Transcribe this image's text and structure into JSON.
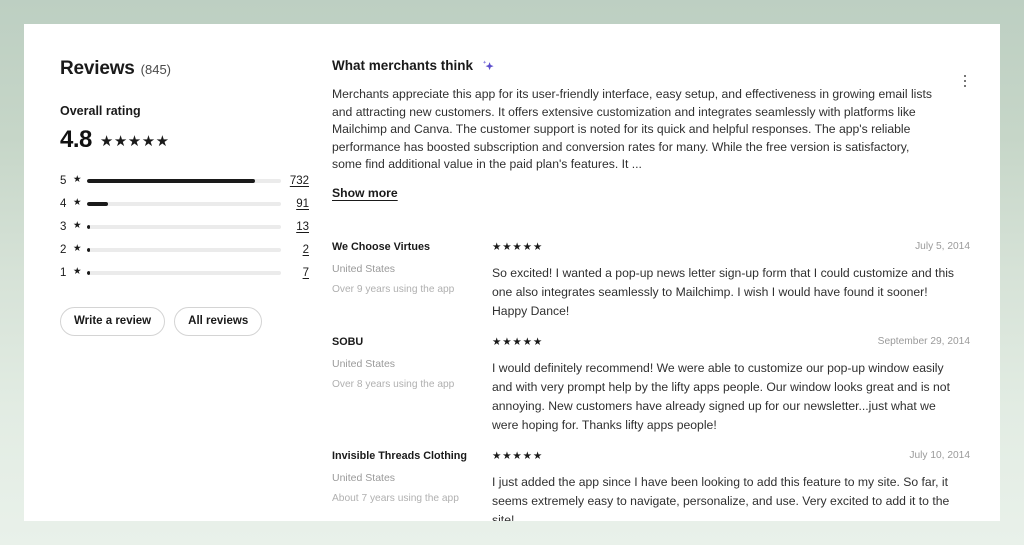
{
  "page": {
    "background_top": "#bdcfc2",
    "background_bottom": "#e9f1ea",
    "card_background": "#ffffff"
  },
  "sidebar": {
    "title": "Reviews",
    "count_label": "(845)",
    "overall_rating_label": "Overall rating",
    "score": "4.8",
    "score_stars": "★★★★★",
    "rating_bars": [
      {
        "stars": "5",
        "star_glyph": "★",
        "count": "732",
        "percent": 86.6
      },
      {
        "stars": "4",
        "star_glyph": "★",
        "count": "91",
        "percent": 10.8
      },
      {
        "stars": "3",
        "star_glyph": "★",
        "count": "13",
        "percent": 1.6
      },
      {
        "stars": "2",
        "star_glyph": "★",
        "count": "2",
        "percent": 0.3
      },
      {
        "stars": "1",
        "star_glyph": "★",
        "count": "7",
        "percent": 0.9
      }
    ],
    "write_review_label": "Write a review",
    "all_reviews_label": "All reviews"
  },
  "merchants_summary": {
    "title": "What merchants think",
    "ai_icon": "sparkle-icon",
    "ai_icon_color": "#5c4ecc",
    "menu_icon": "kebab-menu-icon",
    "body": "Merchants appreciate this app for its user-friendly interface, easy setup, and effectiveness in growing email lists and attracting new customers. It offers extensive customization and integrates seamlessly with platforms like Mailchimp and Canva. The customer support is noted for its quick and helpful responses. The app's reliable performance has boosted subscription and conversion rates for many. While the free version is satisfactory, some find additional value in the paid plan's features. It ...",
    "show_more_label": "Show more"
  },
  "reviews": [
    {
      "shop": "We Choose Virtues",
      "country": "United States",
      "duration": "Over 9 years using the app",
      "stars": "★★★★★",
      "date": "July 5, 2014",
      "text": "So excited! I wanted a pop-up news letter sign-up form that I could customize and this one also integrates seamlessly to Mailchimp. I wish I would have found it sooner! Happy Dance!"
    },
    {
      "shop": "SOBU",
      "country": "United States",
      "duration": "Over 8 years using the app",
      "stars": "★★★★★",
      "date": "September 29, 2014",
      "text": "I would definitely recommend! We were able to customize our pop-up window easily and with very prompt help by the lifty apps people. Our window looks great and is not annoying. New customers have already signed up for our newsletter...just what we were hoping for. Thanks lifty apps people!"
    },
    {
      "shop": "Invisible Threads Clothing",
      "country": "United States",
      "duration": "About 7 years using the app",
      "stars": "★★★★★",
      "date": "July 10, 2014",
      "text": "I just added the app since I have been looking to add this feature to my site. So far, it seems extremely easy to navigate, personalize, and use. Very excited to add it to the site!"
    }
  ]
}
